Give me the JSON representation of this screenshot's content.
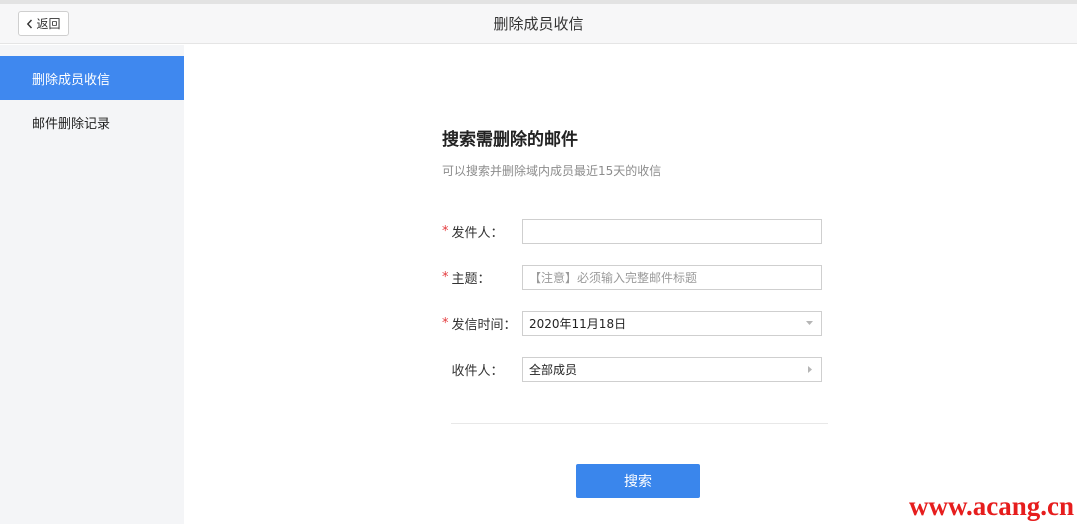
{
  "header": {
    "back_label": "返回",
    "title": "删除成员收信"
  },
  "sidebar": {
    "items": [
      {
        "label": "删除成员收信",
        "active": true
      },
      {
        "label": "邮件删除记录",
        "active": false
      }
    ]
  },
  "main": {
    "title": "搜索需删除的邮件",
    "subtitle": "可以搜索并删除域内成员最近15天的收信",
    "form": {
      "sender": {
        "required_mark": "*",
        "label": "发件人：",
        "value": ""
      },
      "subject": {
        "required_mark": "*",
        "label": "主题：",
        "placeholder": "【注意】必须输入完整邮件标题"
      },
      "send_time": {
        "required_mark": "*",
        "label": "发信时间：",
        "value": "2020年11月18日"
      },
      "recipient": {
        "required_mark": "*",
        "label": "收件人：",
        "value": "全部成员"
      }
    },
    "search_label": "搜索"
  },
  "watermark": "www.acang.cn",
  "colors": {
    "accent": "#3f88ef",
    "button": "#3a86ec",
    "required": "#e4393c",
    "watermark": "#e61d1d"
  },
  "icons": {
    "back": "chevron-left-icon",
    "dropdown": "caret-down-icon",
    "expand": "caret-right-icon"
  }
}
